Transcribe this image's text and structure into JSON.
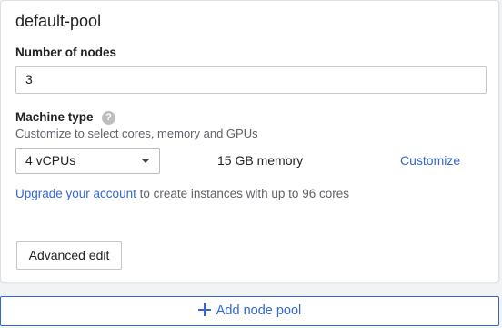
{
  "pool": {
    "title": "default-pool",
    "nodes_label": "Number of nodes",
    "nodes_value": "3",
    "machine_type_label": "Machine type",
    "help_icon_glyph": "?",
    "machine_type_hint": "Customize to select cores, memory and GPUs",
    "machine_type_selected": "4 vCPUs",
    "memory_text": "15 GB memory",
    "customize_label": "Customize",
    "upgrade_link": "Upgrade your account",
    "upgrade_text": " to create instances with up to 96 cores",
    "advanced_edit_label": "Advanced edit"
  },
  "add_node_pool_label": "Add node pool",
  "colors": {
    "accent": "#3367d6",
    "text": "#202124",
    "muted": "#5f6368"
  }
}
